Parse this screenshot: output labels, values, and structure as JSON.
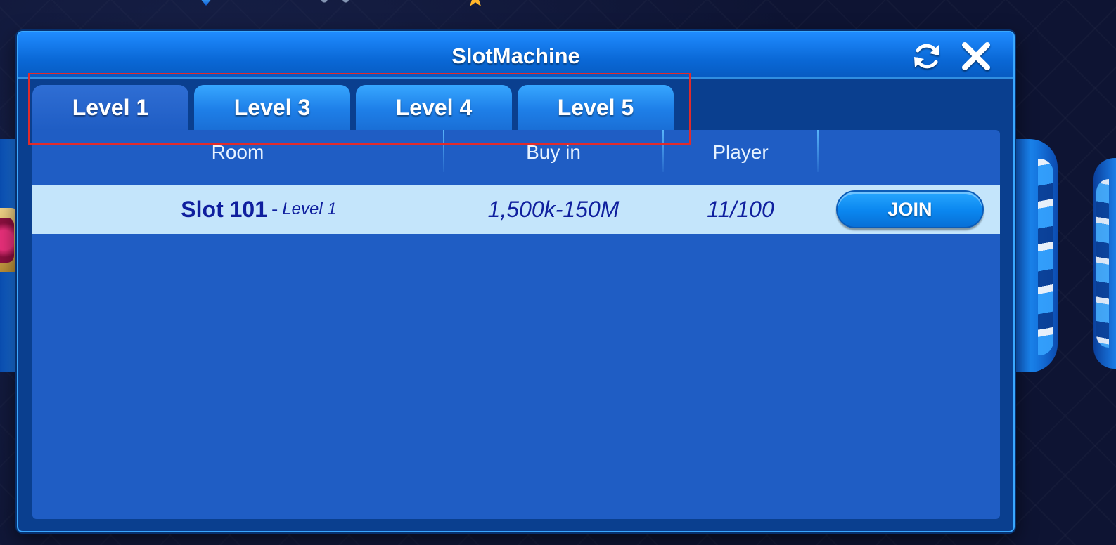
{
  "dialog": {
    "title": "SlotMachine",
    "refresh_icon": "refresh-icon",
    "close_icon": "close-icon"
  },
  "tabs": [
    {
      "label": "Level 1",
      "active": true
    },
    {
      "label": "Level 3",
      "active": false
    },
    {
      "label": "Level 4",
      "active": false
    },
    {
      "label": "Level 5",
      "active": false
    }
  ],
  "table": {
    "headers": [
      "Room",
      "Buy in",
      "Player",
      ""
    ],
    "rows": [
      {
        "room_name": "Slot 101",
        "separator": "-",
        "room_level": "Level  1",
        "buy_in": "1,500k-150M",
        "players": "11/100",
        "action": "JOIN"
      }
    ]
  },
  "colors": {
    "dialog_bg": "#0a3f8f",
    "panel_bg": "#1f5dc4",
    "row_bg": "#c4e5fb",
    "row_text": "#0f1f9e",
    "button_blue": "#0a86ef",
    "highlight_red": "#e12b2b"
  }
}
